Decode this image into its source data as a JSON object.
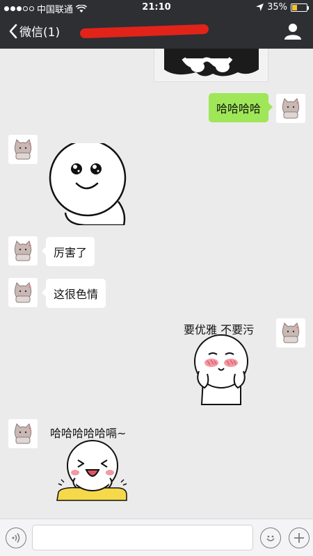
{
  "status_bar": {
    "carrier": "中国联通",
    "time": "21:10",
    "battery": "35%",
    "battery_level": 0.35
  },
  "nav": {
    "back_label": "微信(1)"
  },
  "messages": [
    {
      "from": "me",
      "type": "text",
      "text": "哈哈哈哈"
    },
    {
      "from": "other",
      "type": "sticker",
      "sticker": "happy-face-sticker"
    },
    {
      "from": "other",
      "type": "text",
      "text": "厉害了"
    },
    {
      "from": "other",
      "type": "text",
      "text": "这很色情"
    },
    {
      "from": "me",
      "type": "sticker",
      "caption": "要优雅 不要污",
      "sticker": "blushing-face-sticker"
    },
    {
      "from": "other",
      "type": "sticker",
      "caption": "哈哈哈哈哈嗝~",
      "sticker": "laughing-face-sticker"
    }
  ],
  "input": {
    "placeholder": ""
  },
  "colors": {
    "nav_bg": "#2d2f33",
    "chat_bg": "#ebebeb",
    "my_bubble": "#9fe658",
    "other_bubble": "#ffffff",
    "redaction": "#e2231a"
  }
}
